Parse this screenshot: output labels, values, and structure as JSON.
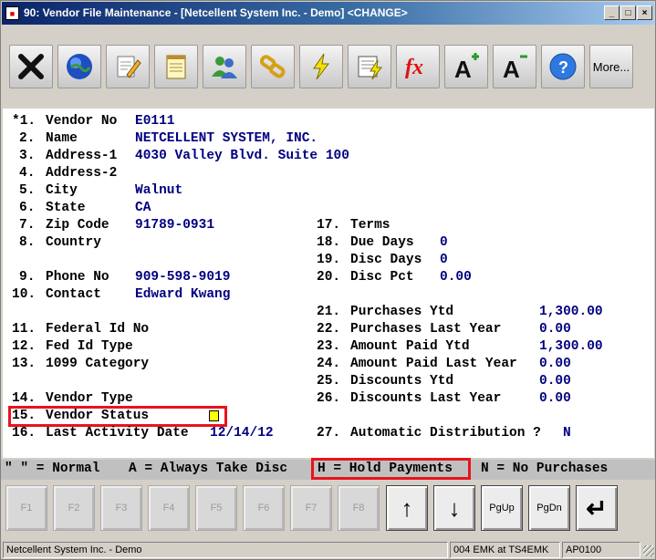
{
  "window": {
    "title": "90: Vendor File Maintenance - [Netcellent System Inc. - Demo] <CHANGE>"
  },
  "toolbar": {
    "icons": [
      "exit-icon",
      "internet-icon",
      "edit-notes-icon",
      "memo-icon",
      "contacts-icon",
      "links-icon",
      "lightning-icon",
      "report-lightning-icon",
      "function-icon",
      "increase-font-icon",
      "decrease-font-icon",
      "help-icon"
    ],
    "more_label": "More..."
  },
  "fields": [
    {
      "num": "*1.",
      "label": "Vendor No",
      "value": "E0111"
    },
    {
      "num": "2.",
      "label": "Name",
      "value": "NETCELLENT SYSTEM, INC."
    },
    {
      "num": "3.",
      "label": "Address-1",
      "value": "4030 Valley Blvd. Suite 100"
    },
    {
      "num": "4.",
      "label": "Address-2",
      "value": ""
    },
    {
      "num": "5.",
      "label": "City",
      "value": "Walnut"
    },
    {
      "num": "6.",
      "label": "State",
      "value": "CA"
    },
    {
      "num": "7.",
      "label": "Zip Code",
      "value": "91789-0931"
    },
    {
      "num": "8.",
      "label": "Country",
      "value": ""
    },
    {
      "num": "9.",
      "label": "Phone No",
      "value": "909-598-9019"
    },
    {
      "num": "10.",
      "label": "Contact",
      "value": "Edward Kwang"
    },
    {
      "num": "11.",
      "label": "Federal Id No",
      "value": ""
    },
    {
      "num": "12.",
      "label": "Fed Id Type",
      "value": ""
    },
    {
      "num": "13.",
      "label": "1099 Category",
      "value": ""
    },
    {
      "num": "14.",
      "label": "Vendor Type",
      "value": ""
    },
    {
      "num": "15.",
      "label": "Vendor Status",
      "value": ""
    },
    {
      "num": "16.",
      "label": "Last Activity Date",
      "value": "12/14/12"
    },
    {
      "num": "17.",
      "label": "Terms",
      "value": ""
    },
    {
      "num": "18.",
      "label": "Due Days",
      "value": "0"
    },
    {
      "num": "19.",
      "label": "Disc Days",
      "value": "0"
    },
    {
      "num": "20.",
      "label": "Disc Pct",
      "value": "0.00"
    },
    {
      "num": "21.",
      "label": "Purchases Ytd",
      "value": "1,300.00"
    },
    {
      "num": "22.",
      "label": "Purchases Last Year",
      "value": "0.00"
    },
    {
      "num": "23.",
      "label": "Amount Paid Ytd",
      "value": "1,300.00"
    },
    {
      "num": "24.",
      "label": "Amount Paid Last Year",
      "value": "0.00"
    },
    {
      "num": "25.",
      "label": "Discounts Ytd",
      "value": "0.00"
    },
    {
      "num": "26.",
      "label": "Discounts Last Year",
      "value": "0.00"
    },
    {
      "num": "27.",
      "label": "Automatic Distribution ?",
      "value": "N"
    }
  ],
  "legend": {
    "normal": "\" \" = Normal",
    "always": "A = Always Take Disc",
    "hold": "H = Hold Payments",
    "none": "N = No Purchases"
  },
  "fkeys": [
    "F1",
    "F2",
    "F3",
    "F4",
    "F5",
    "F6",
    "F7",
    "F8"
  ],
  "navkeys": {
    "up": "↑",
    "down": "↓",
    "pgup": "PgUp",
    "pgdn": "PgDn",
    "enter": "↵"
  },
  "status": {
    "company": "Netcellent System Inc. - Demo",
    "session": "004 EMK at TS4EMK",
    "program": "AP0100"
  },
  "colors": {
    "value_text": "#000080",
    "highlight_box": "#e8131b",
    "status_indicator": "#ffff00"
  }
}
